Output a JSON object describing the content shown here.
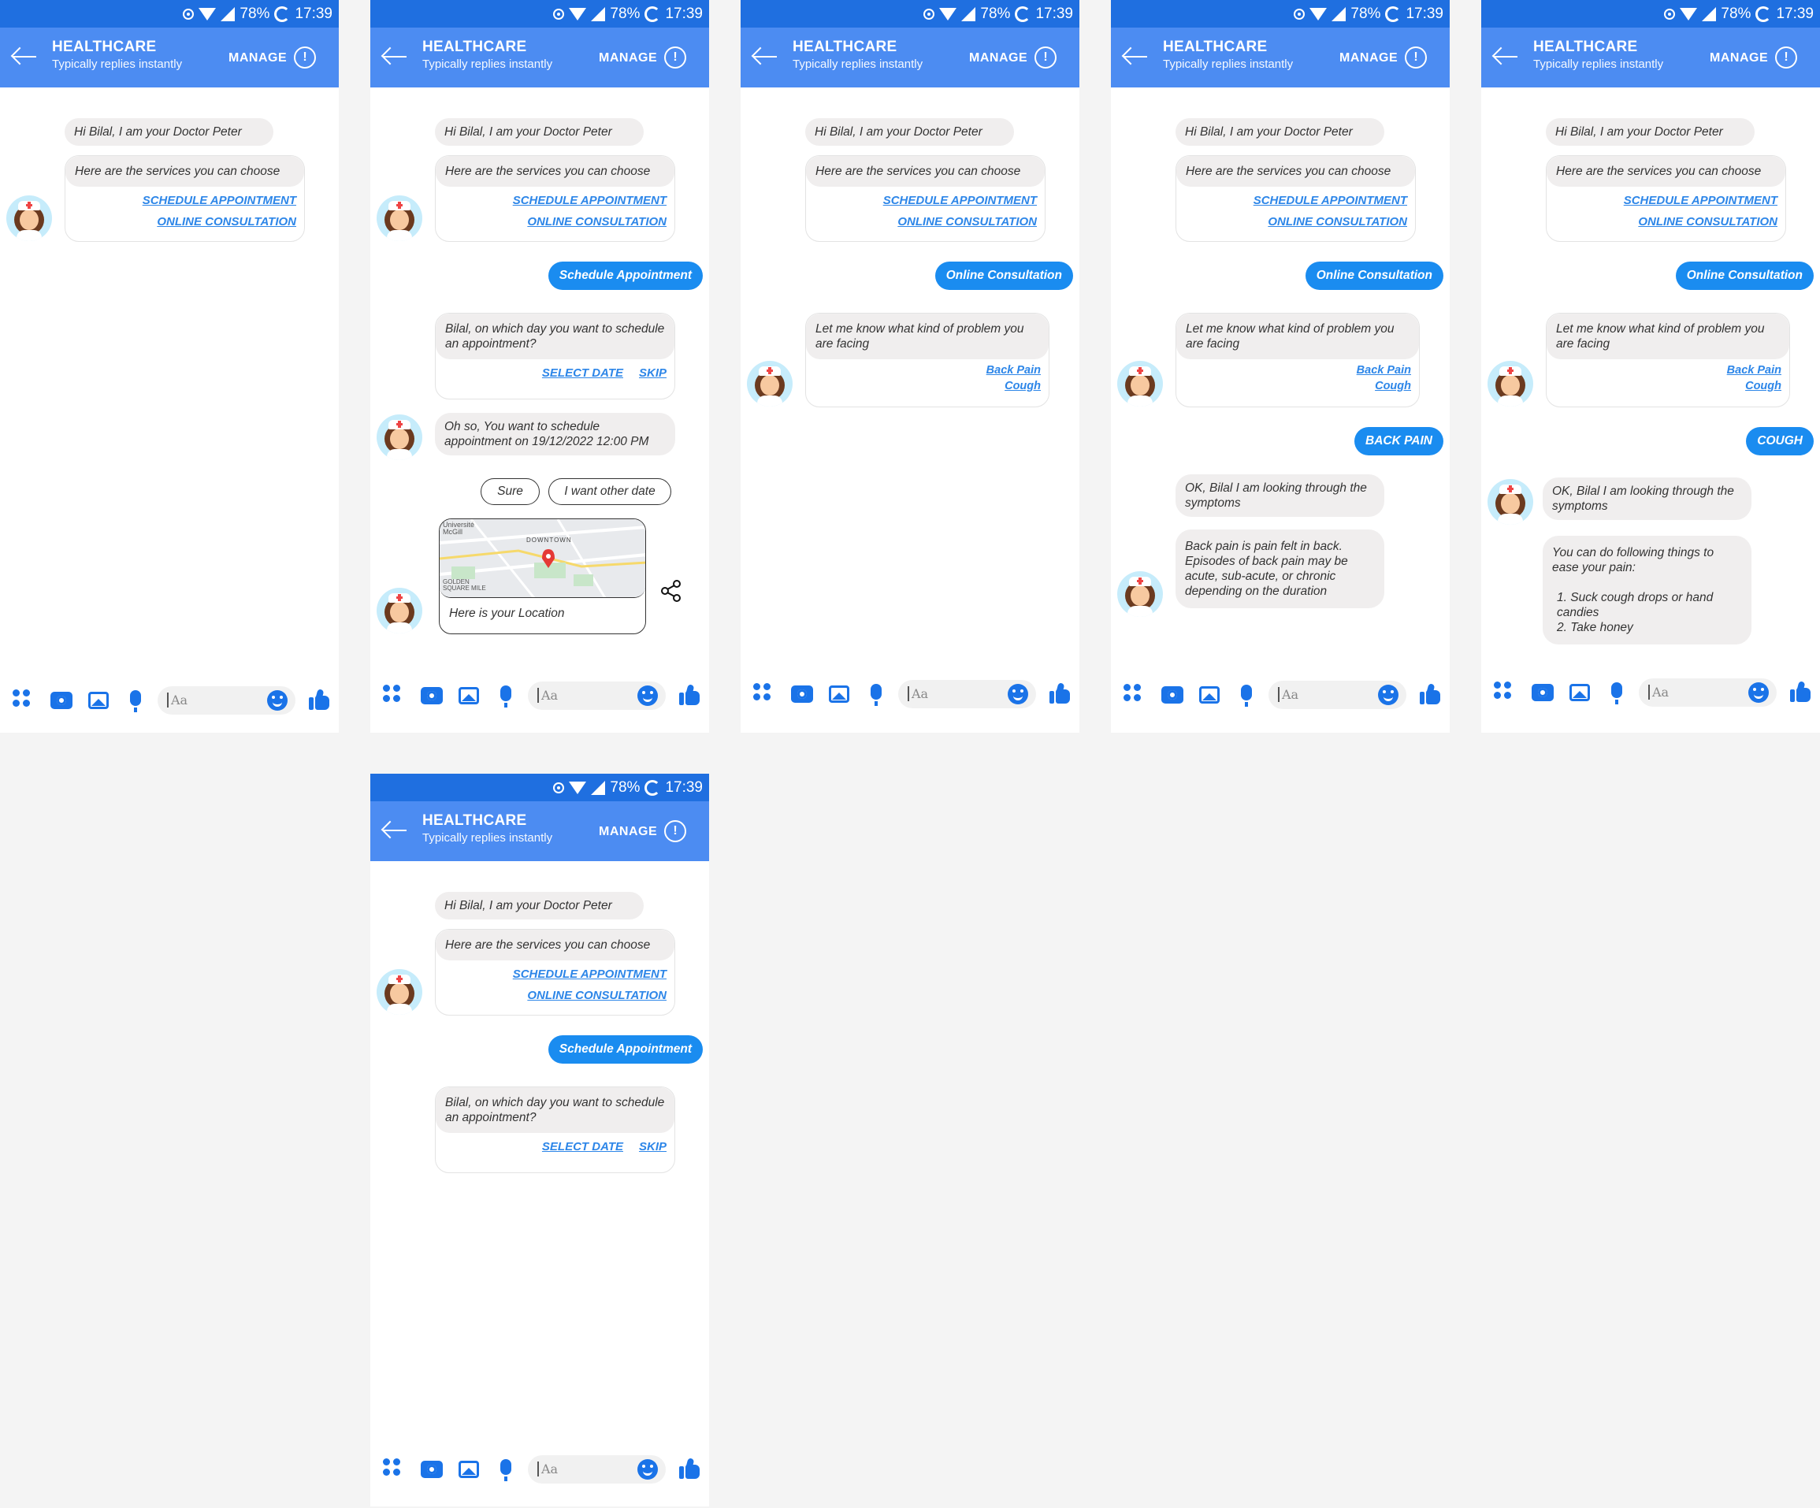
{
  "status": {
    "battery": "78%",
    "time": "17:39"
  },
  "header": {
    "title": "HEALTHCARE",
    "subtitle": "Typically replies instantly",
    "manage": "MANAGE",
    "info_symbol": "!"
  },
  "messages": {
    "greeting": "Hi Bilal, I am your Doctor Peter",
    "services_prompt": "Here are the services you can choose",
    "opt_schedule": "SCHEDULE APPOINTMENT",
    "opt_online": "ONLINE CONSULTATION",
    "user_schedule": "Schedule Appointment",
    "user_online": "Online Consultation",
    "day_prompt": "Bilal, on which day you want to schedule an appointment?",
    "select_date": "SELECT DATE",
    "skip": "SKIP",
    "confirm_date": "Oh so, You want to schedule appointment on 19/12/2022 12:00 PM",
    "reply_sure": "Sure",
    "reply_other_date": "I want other date",
    "location_caption": "Here is your Location",
    "problem_prompt": "Let me know what kind of problem you are facing",
    "opt_back_pain": "Back Pain",
    "opt_cough": "Cough",
    "user_back_pain": "BACK PAIN",
    "user_cough": "COUGH",
    "looking_symptoms": "OK, Bilal I am looking through the symptoms",
    "back_pain_info": "Back pain is pain felt in back. Episodes of back pain may be acute, sub-acute, or chronic depending on the duration",
    "cough_intro": "You can do following things to ease your pain:",
    "cough_tip_1": "1.  Suck cough drops or hand candies",
    "cough_tip_2": "2.  Take honey"
  },
  "map": {
    "label_mcgill": "Université McGill",
    "label_downtown": "DOWNTOWN",
    "label_golden": "GOLDEN SQUARE MILE"
  },
  "composer": {
    "placeholder": "Aa"
  },
  "colors": {
    "status_bar": "#1f6fe0",
    "app_bar": "#4c8cf2",
    "user_bubble": "#1a8cf0",
    "link": "#2d86e8"
  }
}
